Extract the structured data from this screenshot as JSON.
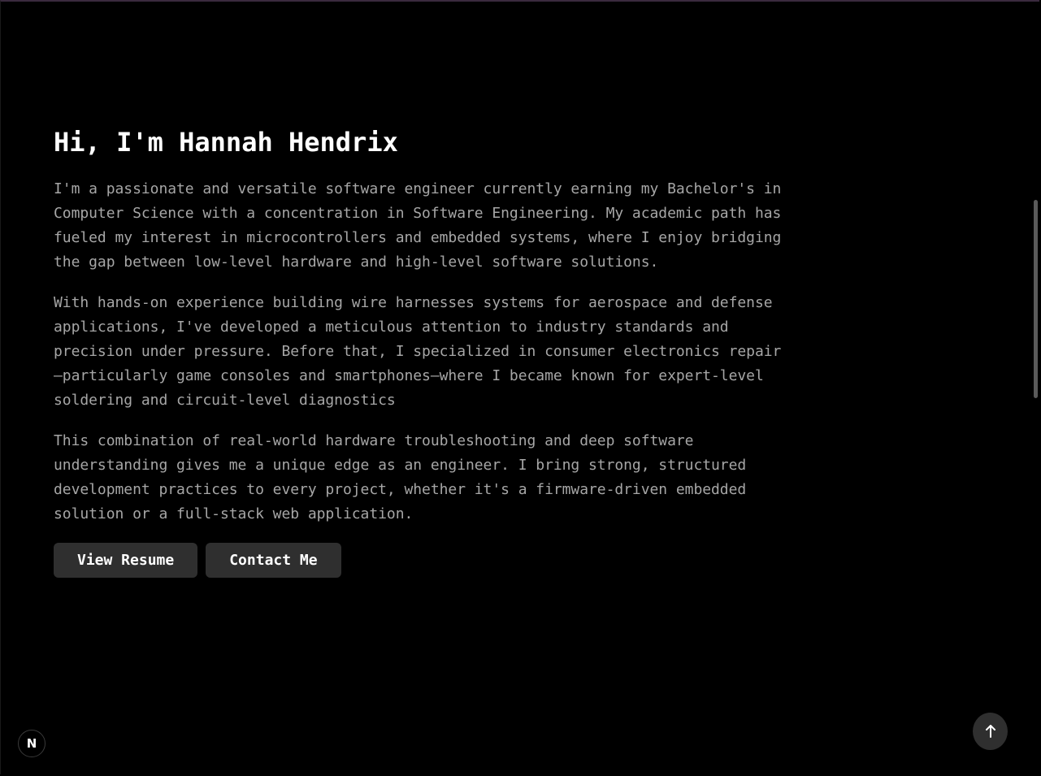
{
  "hero": {
    "title": "Hi, I'm Hannah Hendrix",
    "paragraphs": [
      "I'm a passionate and versatile software engineer currently earning my Bachelor's in Computer Science with a concentration in Software Engineering. My academic path has fueled my interest in microcontrollers and embedded systems, where I enjoy bridging the gap between low-level hardware and high-level software solutions.",
      "With hands-on experience building wire harnesses systems for aerospace and defense applications, I've developed a meticulous attention to industry standards and precision under pressure. Before that, I specialized in consumer electronics repair—particularly game consoles and smartphones—where I became known for expert-level soldering and circuit-level diagnostics",
      "This combination of real-world hardware troubleshooting and deep software understanding gives me a unique edge as an engineer. I bring strong, structured development practices to every project, whether it's a firmware-driven embedded solution or a full-stack web application."
    ],
    "buttons": {
      "resume_label": "View Resume",
      "contact_label": "Contact Me"
    }
  },
  "floating": {
    "next_badge_label": "N",
    "to_top_icon": "arrow-up-icon"
  },
  "colors": {
    "background": "#000000",
    "title": "#ffffff",
    "body_text": "#a6a6a6",
    "button_bg": "#2f2f2f"
  }
}
